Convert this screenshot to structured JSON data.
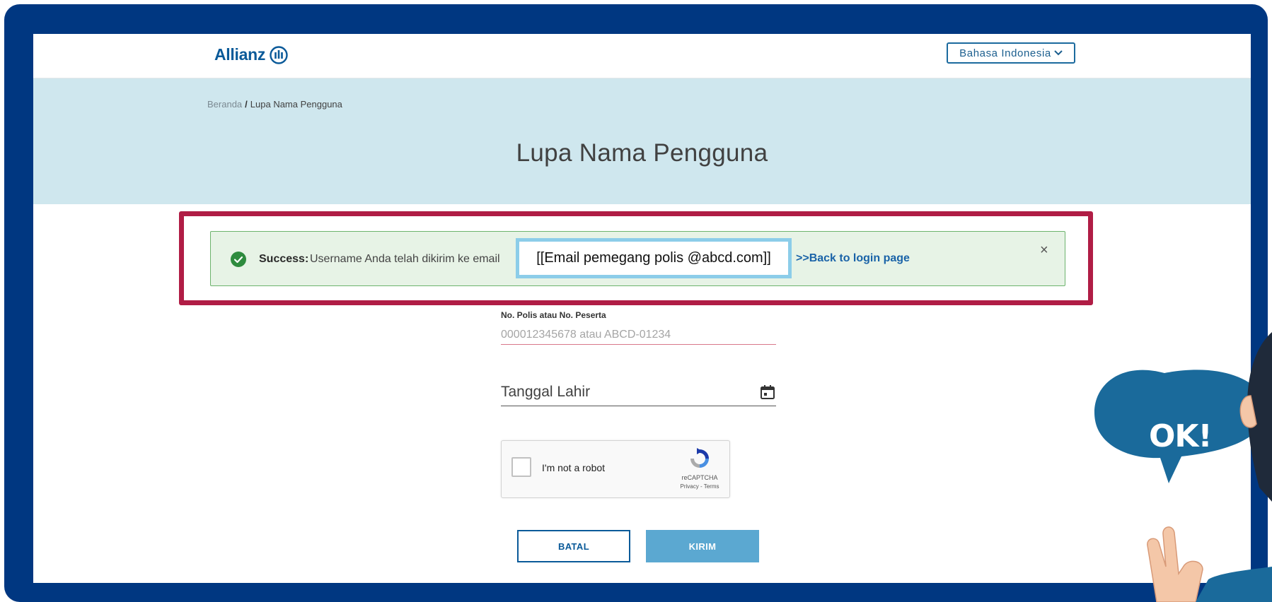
{
  "header": {
    "logo_text": "Allianz",
    "language_button": "Bahasa Indonesia"
  },
  "breadcrumb": {
    "home": "Beranda",
    "separator": "/",
    "current": "Lupa Nama Pengguna"
  },
  "page_title": "Lupa Nama Pengguna",
  "alert": {
    "label": "Success:",
    "message": "Username Anda telah dikirim ke email",
    "email": "[[Email pemegang polis @abcd.com]]",
    "back_link": ">>Back to login page",
    "close": "×",
    "status_color": "#2e8b3e"
  },
  "form": {
    "policy_label": "No. Polis atau No. Peserta",
    "policy_placeholder": "000012345678 atau ABCD-01234",
    "policy_value": "",
    "birthdate_label": "Tanggal Lahir",
    "recaptcha": {
      "label": "I'm not a robot",
      "brand": "reCAPTCHA",
      "terms": "Privacy - Terms"
    },
    "cancel_button": "BATAL",
    "submit_button": "KIRIM"
  },
  "mascot": {
    "bubble_text": "OK!"
  },
  "colors": {
    "frame": "#003781",
    "brand_blue": "#0a5a99",
    "banner": "#cfe7ee",
    "highlight": "#b01d45",
    "email_highlight": "#8ccde9",
    "submit": "#5ba8d1"
  }
}
